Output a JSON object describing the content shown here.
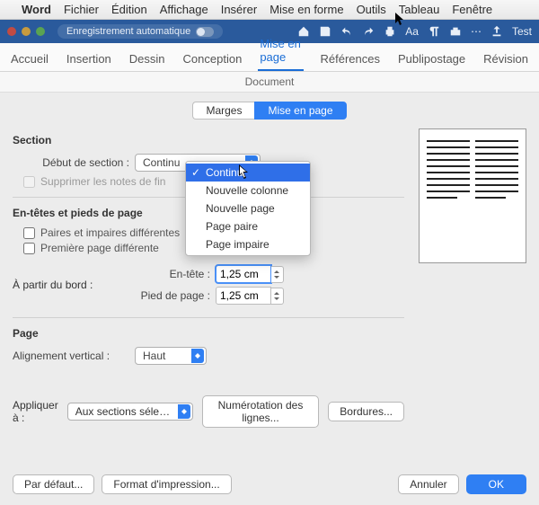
{
  "menubar": {
    "apple": "",
    "app": "Word",
    "items": [
      "Fichier",
      "Édition",
      "Affichage",
      "Insérer",
      "Mise en forme",
      "Outils",
      "Tableau",
      "Fenêtre"
    ]
  },
  "titlebar": {
    "autosave_label": "Enregistrement automatique",
    "test_label": "Test"
  },
  "ribbon": {
    "tabs": [
      "Accueil",
      "Insertion",
      "Dessin",
      "Conception",
      "Mise en page",
      "Références",
      "Publipostage",
      "Révision"
    ],
    "active_index": 4
  },
  "dialog": {
    "title": "Document",
    "segmented": {
      "left": "Marges",
      "right": "Mise en page"
    },
    "section": {
      "heading": "Section",
      "start_label": "Début de section :",
      "start_options": [
        "Continu",
        "Nouvelle colonne",
        "Nouvelle page",
        "Page paire",
        "Page impaire"
      ],
      "start_selected_index": 0,
      "suppress_endnotes": "Supprimer les notes de fin"
    },
    "headers_footers": {
      "heading": "En-têtes et pieds de page",
      "odd_even": "Paires et impaires différentes",
      "first_page": "Première page différente",
      "from_edge": "À partir du bord :",
      "header_label": "En-tête :",
      "footer_label": "Pied de page :",
      "header_value": "1,25 cm",
      "footer_value": "1,25 cm"
    },
    "page": {
      "heading": "Page",
      "valign_label": "Alignement vertical :",
      "valign_value": "Haut"
    },
    "apply": {
      "label": "Appliquer à :",
      "value": "Aux sections séle…",
      "line_numbers": "Numérotation des lignes...",
      "borders": "Bordures..."
    },
    "buttons": {
      "default": "Par défaut...",
      "print_format": "Format d'impression...",
      "cancel": "Annuler",
      "ok": "OK"
    }
  }
}
